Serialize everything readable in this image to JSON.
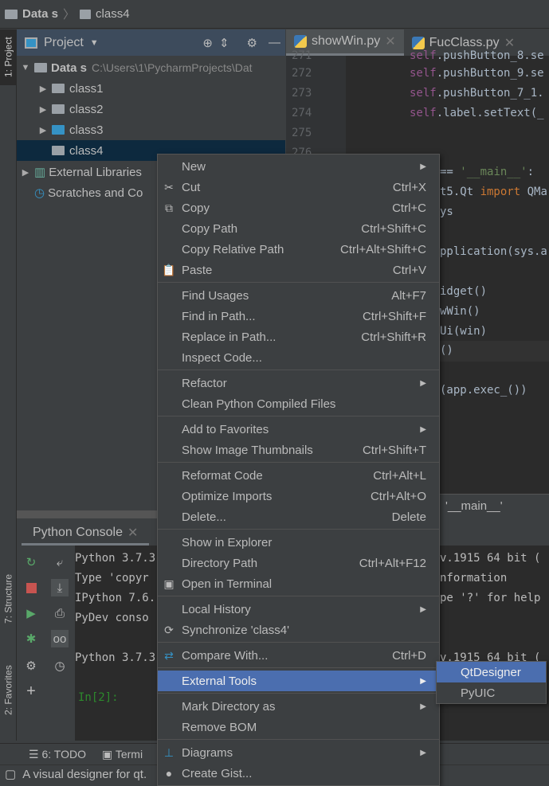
{
  "breadcrumb": [
    "Data s",
    "class4"
  ],
  "sidebar_tabs": {
    "project": "1: Project",
    "structure": "7: Structure",
    "favorites": "2: Favorites"
  },
  "project_panel": {
    "title": "Project",
    "root": {
      "name": "Data s",
      "path": "C:\\Users\\1\\PycharmProjects\\Dat"
    },
    "items": [
      "class1",
      "class2",
      "class3",
      "class4"
    ],
    "external": "External Libraries",
    "scratches": "Scratches and Co"
  },
  "editor": {
    "tabs": [
      "showWin.py",
      "FucClass.py"
    ],
    "line_numbers": [
      "271",
      "272",
      "273",
      "274",
      "275",
      "276"
    ],
    "lines": [
      {
        "self": "self",
        "rest": ".pushButton_8.se"
      },
      {
        "self": "self",
        "rest": ".pushButton_9.se"
      },
      {
        "self": "self",
        "rest": ".pushButton_7_1."
      },
      {
        "self": "self",
        "rest": ".label.setText(_"
      }
    ],
    "fragments": {
      "main_cond": "== ",
      "main_str": "'__main__'",
      "colon": ":",
      "import_pre": "t5.Qt ",
      "import_kw": "import",
      "import_post": " QMa",
      "sys": "ys",
      "app": "pplication(sys.a",
      "widget": "idget()",
      "win": "wWin()",
      "ui": "Ui(win)",
      "show": "()",
      "exec": "(app.exec_())"
    },
    "breadcrumb_bottom": "'__main__'"
  },
  "console": {
    "tab": "Python Console",
    "lines": [
      "Python 3.7.3",
      "Type 'copyr",
      "IPython 7.6.",
      "PyDev conso",
      "",
      "Python 3.7.3"
    ],
    "right": [
      "v.1915 64 bit (",
      "nformation",
      "pe '?' for help",
      "",
      "",
      "v.1915 64 bit ("
    ],
    "prompt": "In[2]:"
  },
  "bottom_tabs": {
    "todo": "6: TODO",
    "terminal": "Termi"
  },
  "status": "A visual designer for qt.",
  "menu": [
    {
      "label": "New",
      "submenu": true
    },
    {
      "label": "Cut",
      "shortcut": "Ctrl+X",
      "icon": "scissors"
    },
    {
      "label": "Copy",
      "shortcut": "Ctrl+C",
      "icon": "copy"
    },
    {
      "label": "Copy Path",
      "shortcut": "Ctrl+Shift+C"
    },
    {
      "label": "Copy Relative Path",
      "shortcut": "Ctrl+Alt+Shift+C"
    },
    {
      "label": "Paste",
      "shortcut": "Ctrl+V",
      "icon": "clipboard",
      "sep_after": true
    },
    {
      "label": "Find Usages",
      "shortcut": "Alt+F7"
    },
    {
      "label": "Find in Path...",
      "shortcut": "Ctrl+Shift+F"
    },
    {
      "label": "Replace in Path...",
      "shortcut": "Ctrl+Shift+R"
    },
    {
      "label": "Inspect Code...",
      "sep_after": true
    },
    {
      "label": "Refactor",
      "submenu": true
    },
    {
      "label": "Clean Python Compiled Files",
      "sep_after": true
    },
    {
      "label": "Add to Favorites",
      "submenu": true
    },
    {
      "label": "Show Image Thumbnails",
      "shortcut": "Ctrl+Shift+T",
      "sep_after": true
    },
    {
      "label": "Reformat Code",
      "shortcut": "Ctrl+Alt+L"
    },
    {
      "label": "Optimize Imports",
      "shortcut": "Ctrl+Alt+O"
    },
    {
      "label": "Delete...",
      "shortcut": "Delete",
      "sep_after": true
    },
    {
      "label": "Show in Explorer"
    },
    {
      "label": "Directory Path",
      "shortcut": "Ctrl+Alt+F12"
    },
    {
      "label": "Open in Terminal",
      "icon": "terminal",
      "sep_after": true
    },
    {
      "label": "Local History",
      "submenu": true
    },
    {
      "label": "Synchronize 'class4'",
      "icon": "sync",
      "sep_after": true
    },
    {
      "label": "Compare With...",
      "shortcut": "Ctrl+D",
      "icon": "compare",
      "sep_after": true
    },
    {
      "label": "External Tools",
      "submenu": true,
      "highlighted": true,
      "sep_after": true
    },
    {
      "label": "Mark Directory as",
      "submenu": true
    },
    {
      "label": "Remove BOM",
      "sep_after": true
    },
    {
      "label": "Diagrams",
      "submenu": true,
      "icon": "diagram"
    },
    {
      "label": "Create Gist...",
      "icon": "github"
    }
  ],
  "submenu": [
    "QtDesigner",
    "PyUIC"
  ],
  "colors": {
    "highlight": "#4b6eaf",
    "selection": "#0d293e",
    "editor_bg": "#2b2b2b",
    "panel_bg": "#3c3f41"
  }
}
